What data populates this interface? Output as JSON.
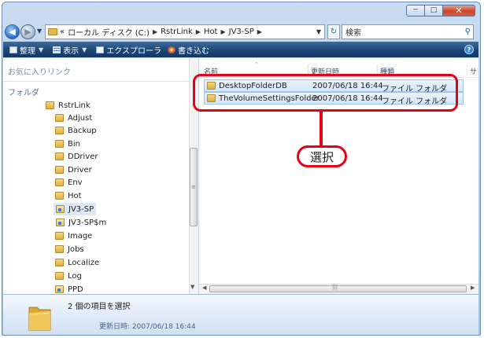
{
  "window": {
    "buttons": {
      "minimize": "─",
      "maximize": "□",
      "close": "✕"
    }
  },
  "navigation": {
    "back_icon": "back-arrow-icon",
    "forward_icon": "forward-arrow-icon",
    "address": {
      "prefix": "«",
      "breadcrumbs": [
        "ローカル ディスク (C:)",
        "RstrLink",
        "Hot",
        "JV3-SP"
      ]
    },
    "search_placeholder": "検索"
  },
  "toolbar": {
    "items": [
      {
        "label": "整理",
        "has_dropdown": true
      },
      {
        "label": "表示",
        "has_dropdown": true
      },
      {
        "label": "エクスプローラ",
        "has_dropdown": false
      },
      {
        "label": "書き込む",
        "has_dropdown": false
      }
    ]
  },
  "left_pane": {
    "favorites_label": "お気に入りリンク",
    "folders_label": "フォルダ",
    "tree": [
      {
        "label": "RstrLink",
        "depth": 0,
        "kind": "folder"
      },
      {
        "label": "Adjust",
        "depth": 1,
        "kind": "folder"
      },
      {
        "label": "Backup",
        "depth": 1,
        "kind": "folder"
      },
      {
        "label": "Bin",
        "depth": 1,
        "kind": "folder"
      },
      {
        "label": "DDriver",
        "depth": 1,
        "kind": "folder"
      },
      {
        "label": "Driver",
        "depth": 1,
        "kind": "folder"
      },
      {
        "label": "Env",
        "depth": 1,
        "kind": "folder"
      },
      {
        "label": "Hot",
        "depth": 1,
        "kind": "folder"
      },
      {
        "label": "JV3-SP",
        "depth": 2,
        "kind": "shared-folder",
        "selected": true
      },
      {
        "label": "JV3-SP$m",
        "depth": 2,
        "kind": "shared-folder"
      },
      {
        "label": "Image",
        "depth": 1,
        "kind": "folder"
      },
      {
        "label": "Jobs",
        "depth": 1,
        "kind": "folder"
      },
      {
        "label": "Localize",
        "depth": 1,
        "kind": "folder"
      },
      {
        "label": "Log",
        "depth": 1,
        "kind": "folder"
      },
      {
        "label": "PPD",
        "depth": 1,
        "kind": "shared-folder"
      }
    ]
  },
  "file_list": {
    "columns": [
      "名前",
      "更新日時",
      "種類",
      "サ"
    ],
    "rows": [
      {
        "name": "DesktopFolderDB",
        "modified": "2007/06/18 16:44",
        "type": "ファイル フォルダ"
      },
      {
        "name": "TheVolumeSettingsFolder",
        "modified": "2007/06/18 16:44",
        "type": "ファイル フォルダ"
      }
    ]
  },
  "details_pane": {
    "selection_count": "2 個の項目を選択",
    "modified_label": "更新日時:",
    "modified_value": "2007/06/18 16:44"
  },
  "annotation": {
    "label": "選択",
    "color": "#e60012"
  },
  "colors": {
    "toolbar_bg": "#1c4775",
    "selection_bg": "#d3e6f8",
    "annotation_red": "#e60012",
    "folder_yellow": "#deb047"
  }
}
